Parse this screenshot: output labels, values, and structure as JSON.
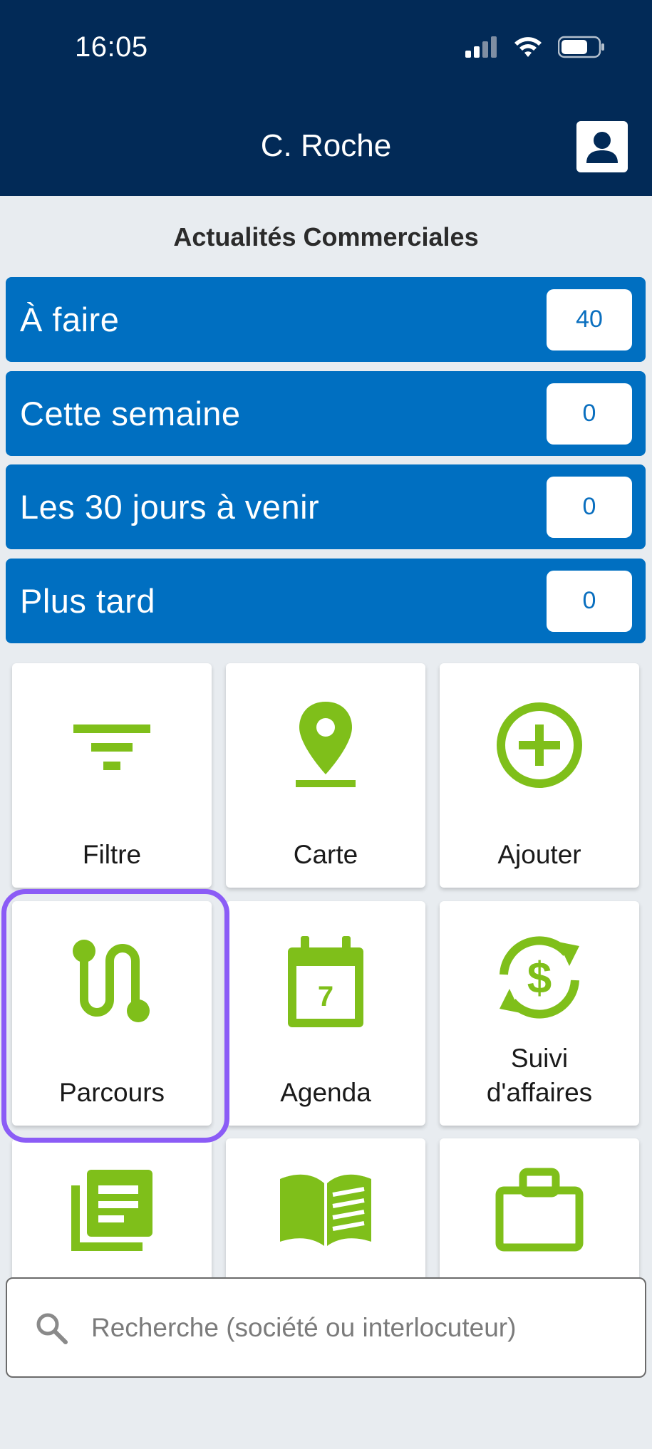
{
  "status_bar": {
    "time": "16:05"
  },
  "header": {
    "title": "C. Roche"
  },
  "section_title": "Actualités Commerciales",
  "news": [
    {
      "label": "À faire",
      "count": "40"
    },
    {
      "label": "Cette semaine",
      "count": "0"
    },
    {
      "label": "Les 30 jours à venir",
      "count": "0"
    },
    {
      "label": "Plus tard",
      "count": "0"
    }
  ],
  "tiles": [
    {
      "label": "Filtre",
      "icon": "filter-icon"
    },
    {
      "label": "Carte",
      "icon": "map-pin-icon"
    },
    {
      "label": "Ajouter",
      "icon": "add-circle-icon"
    },
    {
      "label": "Parcours",
      "icon": "route-icon"
    },
    {
      "label": "Agenda",
      "icon": "calendar-icon"
    },
    {
      "label": "Suivi\nd'affaires",
      "icon": "dollar-cycle-icon"
    },
    {
      "label": "",
      "icon": "documents-icon"
    },
    {
      "label": "",
      "icon": "book-icon"
    },
    {
      "label": "",
      "icon": "briefcase-icon"
    }
  ],
  "calendar_day": "7",
  "search": {
    "placeholder": "Recherche (société ou interlocuteur)"
  },
  "colors": {
    "header": "#022a57",
    "row": "#006fc1",
    "accent": "#7fbf1a",
    "highlight": "#8b5cf6"
  }
}
